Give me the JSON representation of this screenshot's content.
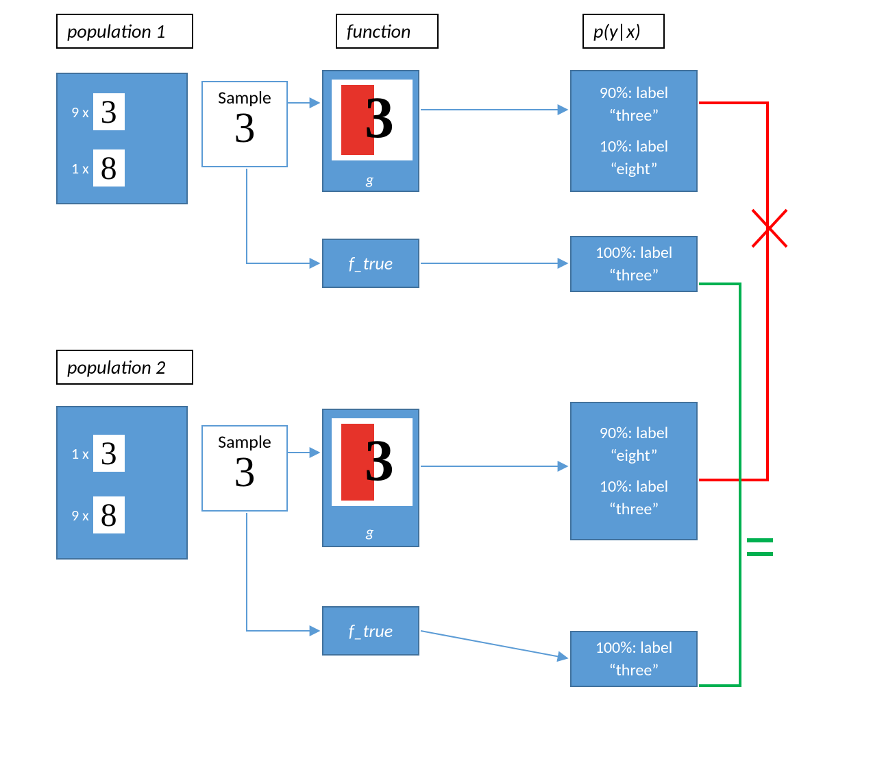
{
  "headers": {
    "pop1": "population 1",
    "pop2": "population 2",
    "function": "function",
    "pyx": "p(y|x)"
  },
  "pop1": {
    "item1_count": "9 x",
    "item1_digit": "3",
    "item2_count": "1 x",
    "item2_digit": "8"
  },
  "pop2": {
    "item1_count": "1 x",
    "item1_digit": "3",
    "item2_count": "9 x",
    "item2_digit": "8"
  },
  "sample": {
    "label": "Sample",
    "digit": "3"
  },
  "func": {
    "digit_overlay": "3",
    "g_label": "g",
    "ftrue_label": "f_true"
  },
  "out": {
    "g1_l1": "90%: label",
    "g1_l2": "“three”",
    "g1_l3": "10%: label",
    "g1_l4": "“eight”",
    "f1_l1": "100%: label",
    "f1_l2": "“three”",
    "g2_l1": "90%: label",
    "g2_l2": "“eight”",
    "g2_l3": "10%: label",
    "g2_l4": "“three”",
    "f2_l1": "100%: label",
    "f2_l2": "“three”"
  },
  "symbols": {
    "not_equal": "✕",
    "equal": "="
  },
  "colors": {
    "blue_fill": "#5B9BD5",
    "blue_border": "#41719C",
    "red": "#E6332A",
    "green": "#00B050",
    "arrow": "#5B9BD5"
  }
}
